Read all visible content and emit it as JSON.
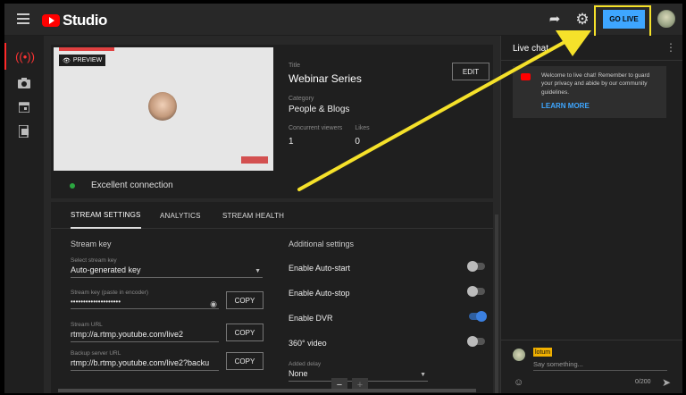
{
  "header": {
    "logo_text": "Studio",
    "go_live_label": "GO LIVE"
  },
  "preview": {
    "badge": "PREVIEW",
    "connection": "Excellent connection",
    "title_label": "Title",
    "title": "Webinar Series",
    "category_label": "Category",
    "category": "People & Blogs",
    "viewers_label": "Concurrent viewers",
    "viewers": "1",
    "likes_label": "Likes",
    "likes": "0",
    "edit_label": "EDIT"
  },
  "tabs": [
    "STREAM SETTINGS",
    "ANALYTICS",
    "STREAM HEALTH"
  ],
  "stream": {
    "section_title": "Stream key",
    "select_label": "Select stream key",
    "select_value": "Auto-generated key",
    "key_label": "Stream key (paste in encoder)",
    "key_value": "••••••••••••••••••••",
    "url_label": "Stream URL",
    "url_value": "rtmp://a.rtmp.youtube.com/live2",
    "backup_label": "Backup server URL",
    "backup_value": "rtmp://b.rtmp.youtube.com/live2?backu",
    "copy_label": "COPY"
  },
  "additional": {
    "section_title": "Additional settings",
    "toggles": [
      {
        "label": "Enable Auto-start",
        "on": false
      },
      {
        "label": "Enable Auto-stop",
        "on": false
      },
      {
        "label": "Enable DVR",
        "on": true
      },
      {
        "label": "360° video",
        "on": false
      }
    ],
    "delay_label": "Added delay",
    "delay_value": "None",
    "minus": "−",
    "plus": "+"
  },
  "chat": {
    "title": "Live chat",
    "welcome": "Welcome to live chat! Remember to guard your privacy and abide by our community guidelines.",
    "learn_more": "LEARN MORE",
    "username": "lotum",
    "placeholder": "Say something...",
    "count": "0/200"
  },
  "colors": {
    "accent": "#3ea6ff",
    "brand": "#ff0000",
    "highlight": "#f5e12a",
    "status_ok": "#2ba640"
  }
}
